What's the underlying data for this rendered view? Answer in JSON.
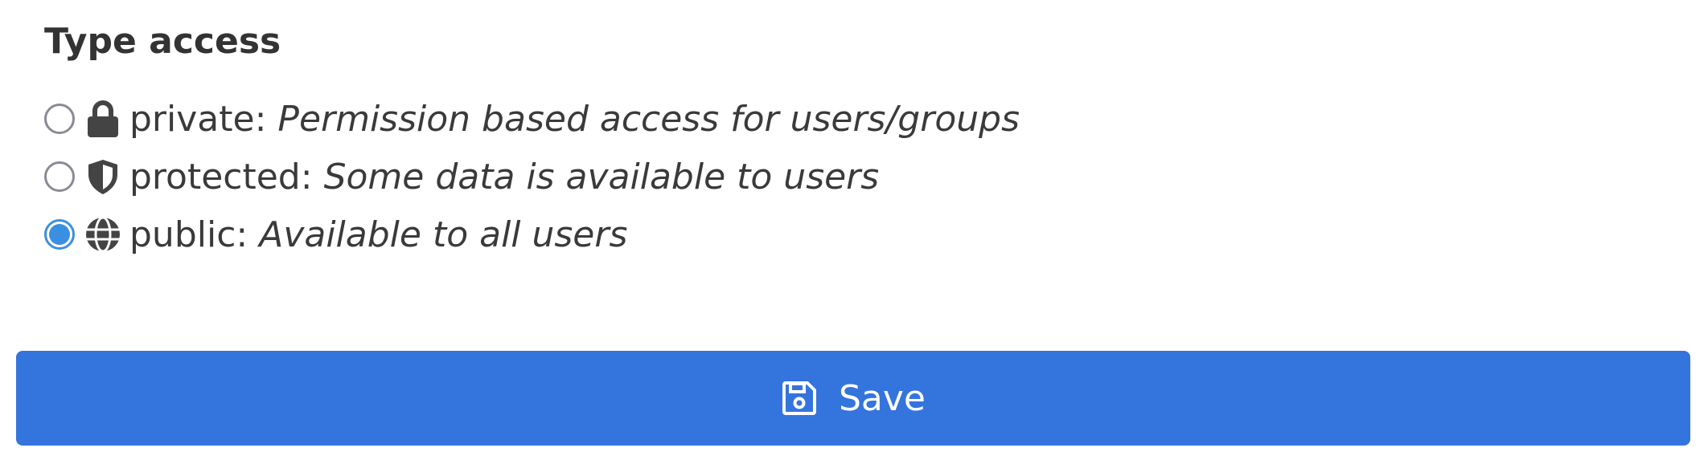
{
  "section": {
    "title": "Type access"
  },
  "options": [
    {
      "name": "private",
      "label": "private:",
      "description": "Permission based access for users/groups",
      "icon": "lock-icon",
      "selected": false
    },
    {
      "name": "protected",
      "label": "protected:",
      "description": "Some data is available to users",
      "icon": "shield-icon",
      "selected": false
    },
    {
      "name": "public",
      "label": "public:",
      "description": "Available to all users",
      "icon": "globe-icon",
      "selected": true
    }
  ],
  "save_button": {
    "label": "Save",
    "icon": "floppy-disk-icon",
    "color": "#3474dd"
  },
  "colors": {
    "radio_selected": "#3b8fe0",
    "radio_border": "#8a8a96",
    "text": "#3a3a3a"
  }
}
